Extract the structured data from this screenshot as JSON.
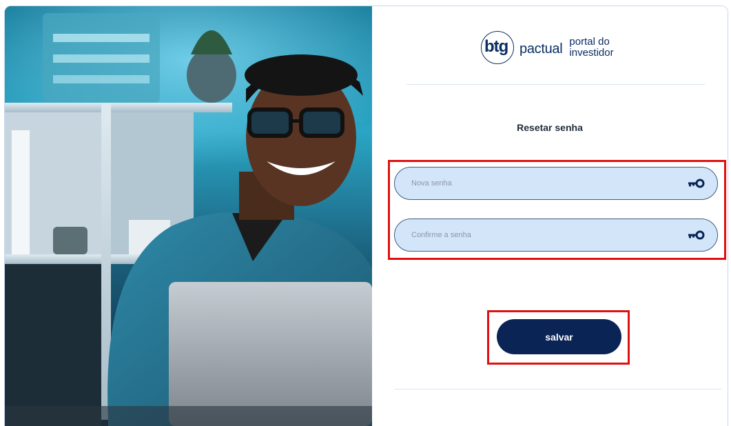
{
  "brand": {
    "logo_mark": "btg",
    "logo_word": "pactual",
    "portal_label": "portal do investidor"
  },
  "photo": {
    "alt_name": "smiling-man-with-laptop-photo"
  },
  "form": {
    "title": "Resetar senha",
    "new_password": {
      "placeholder": "Nova senha",
      "value": "",
      "icon": "key-icon"
    },
    "confirm_password": {
      "placeholder": "Confirme a senha",
      "value": "",
      "icon": "key-icon"
    },
    "save_label": "salvar"
  },
  "colors": {
    "brand_navy": "#0a2456",
    "field_bg": "#d3e5f8",
    "field_border": "#3e5c86",
    "highlight_red": "#e01010"
  }
}
